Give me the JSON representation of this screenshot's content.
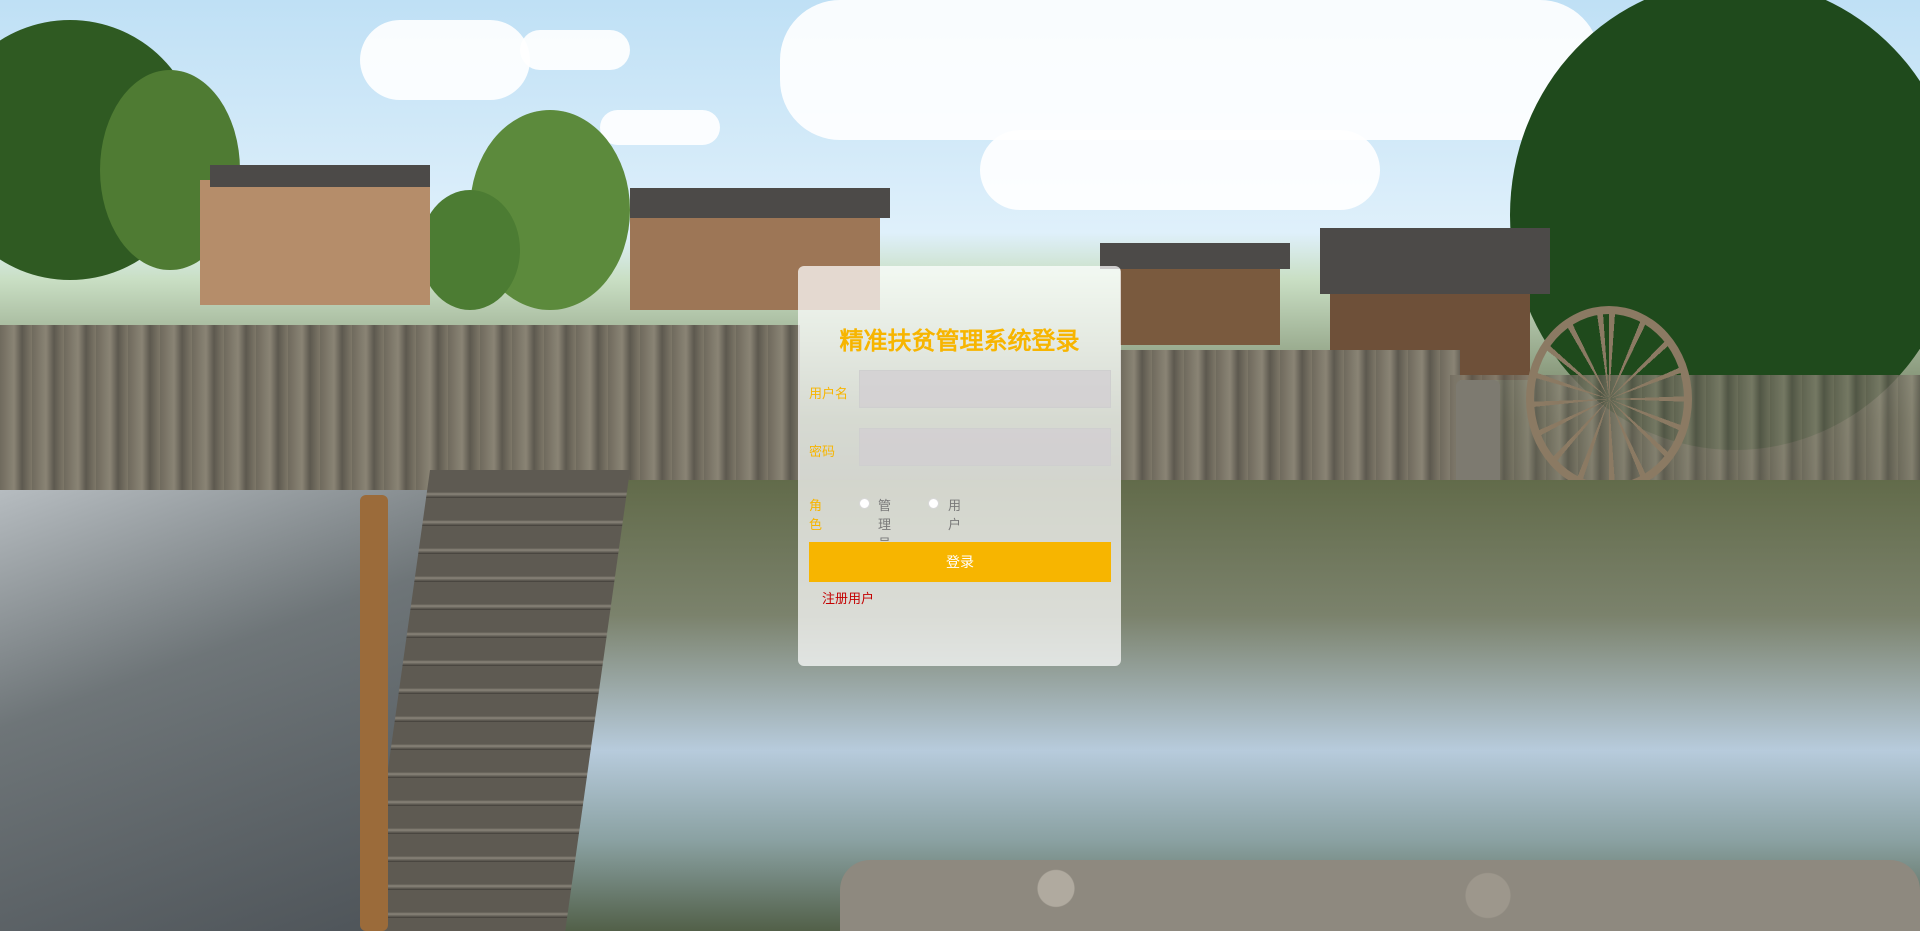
{
  "login": {
    "title": "精准扶贫管理系统登录",
    "username_label": "用户名",
    "username_value": "",
    "password_label": "密码",
    "password_value": "",
    "role_label": "角色",
    "role_options": [
      "管理员",
      "用户"
    ],
    "submit_label": "登录",
    "register_link": "注册用户"
  },
  "colors": {
    "accent": "#f7b500",
    "link": "#c40000",
    "panel_bg": "rgba(255,255,255,0.72)"
  }
}
